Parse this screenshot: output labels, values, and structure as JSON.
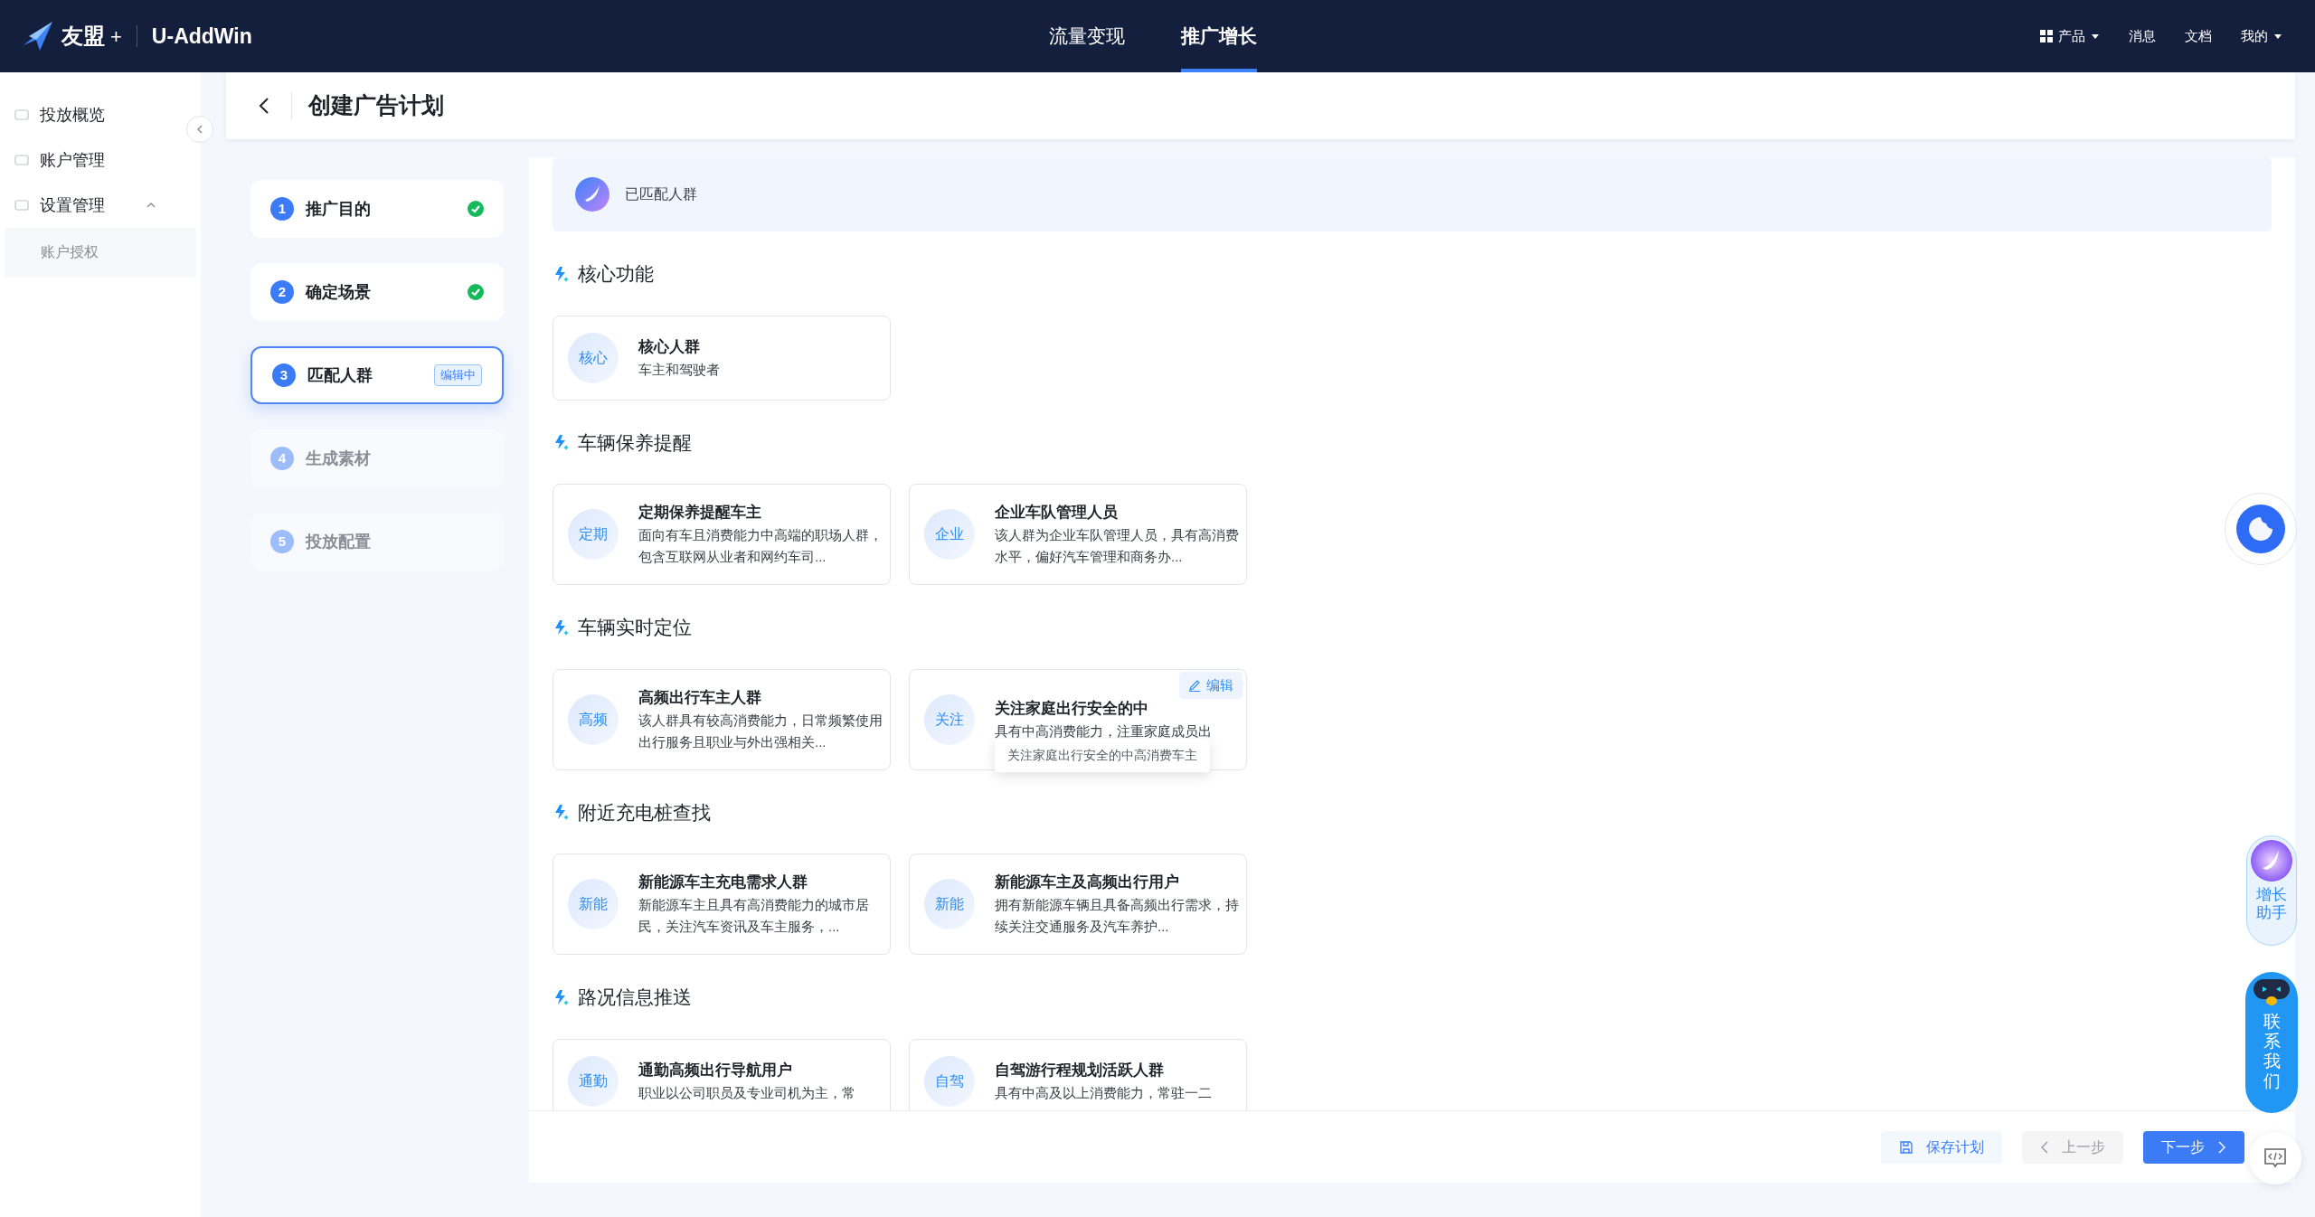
{
  "topbar": {
    "logo": "友盟",
    "logo_plus": "+",
    "product": "U-AddWin",
    "nav": [
      {
        "label": "流量变现",
        "selected": false
      },
      {
        "label": "推广增长",
        "selected": true
      }
    ],
    "right": [
      {
        "label": "产品",
        "kind": "apps"
      },
      {
        "label": "消息",
        "kind": "link"
      },
      {
        "label": "文档",
        "kind": "link"
      },
      {
        "label": "我的",
        "kind": "dropdown"
      }
    ]
  },
  "sidebar": {
    "items": [
      {
        "label": "投放概览"
      },
      {
        "label": "账户管理"
      },
      {
        "label": "设置管理",
        "expanded": true,
        "children": [
          {
            "label": "账户授权"
          }
        ]
      }
    ]
  },
  "header": {
    "title": "创建广告计划"
  },
  "steps": [
    {
      "number": "1",
      "label": "推广目的",
      "completed": true,
      "selected": false
    },
    {
      "number": "2",
      "label": "确定场景",
      "completed": true,
      "selected": false
    },
    {
      "number": "3",
      "label": "匹配人群",
      "completed": false,
      "selected": true,
      "badge": "编辑中"
    },
    {
      "number": "4",
      "label": "生成素材",
      "completed": false,
      "selected": false
    },
    {
      "number": "5",
      "label": "投放配置",
      "completed": false,
      "selected": false
    }
  ],
  "banner": {
    "text": "已匹配人群"
  },
  "sections": [
    {
      "title": "核心功能",
      "cards": [
        {
          "tag": "核心",
          "title": "核心人群",
          "desc": "车主和驾驶者"
        }
      ]
    },
    {
      "title": "车辆保养提醒",
      "cards": [
        {
          "tag": "定期",
          "title": "定期保养提醒车主",
          "desc": "面向有车且消费能力中高端的职场人群，包含互联网从业者和网约车司..."
        },
        {
          "tag": "企业",
          "title": "企业车队管理人员",
          "desc": "该人群为企业车队管理人员，具有高消费水平，偏好汽车管理和商务办..."
        }
      ]
    },
    {
      "title": "车辆实时定位",
      "cards": [
        {
          "tag": "高频",
          "title": "高频出行车主人群",
          "desc": "该人群具有较高消费能力，日常频繁使用出行服务且职业与外出强相关..."
        },
        {
          "tag": "关注",
          "title": "关注家庭出行安全的中",
          "desc": "具有中高消费能力，注重家庭成员出",
          "hovered": true,
          "edit": "编辑",
          "tooltip": "关注家庭出行安全的中高消费车主"
        }
      ]
    },
    {
      "title": "附近充电桩查找",
      "cards": [
        {
          "tag": "新能",
          "title": "新能源车主充电需求人群",
          "desc": "新能源车主且具有高消费能力的城市居民，关注汽车资讯及车主服务，..."
        },
        {
          "tag": "新能",
          "title": "新能源车主及高频出行用户",
          "desc": "拥有新能源车辆且具备高频出行需求，持续关注交通服务及汽车养护..."
        }
      ]
    },
    {
      "title": "路况信息推送",
      "cards": [
        {
          "tag": "通勤",
          "title": "通勤高频出行导航用户",
          "desc": "职业以公司职员及专业司机为主，常"
        },
        {
          "tag": "自驾",
          "title": "自驾游行程规划活跃人群",
          "desc": "具有中高及以上消费能力，常驻一二"
        }
      ]
    }
  ],
  "footer": {
    "buttons": [
      {
        "label": "保存计划",
        "kind": "save"
      },
      {
        "label": "上一步",
        "kind": "prev"
      },
      {
        "label": "下一步",
        "kind": "next"
      }
    ]
  },
  "floating": {
    "assistant": "增长助手",
    "contact": "联系我们"
  }
}
